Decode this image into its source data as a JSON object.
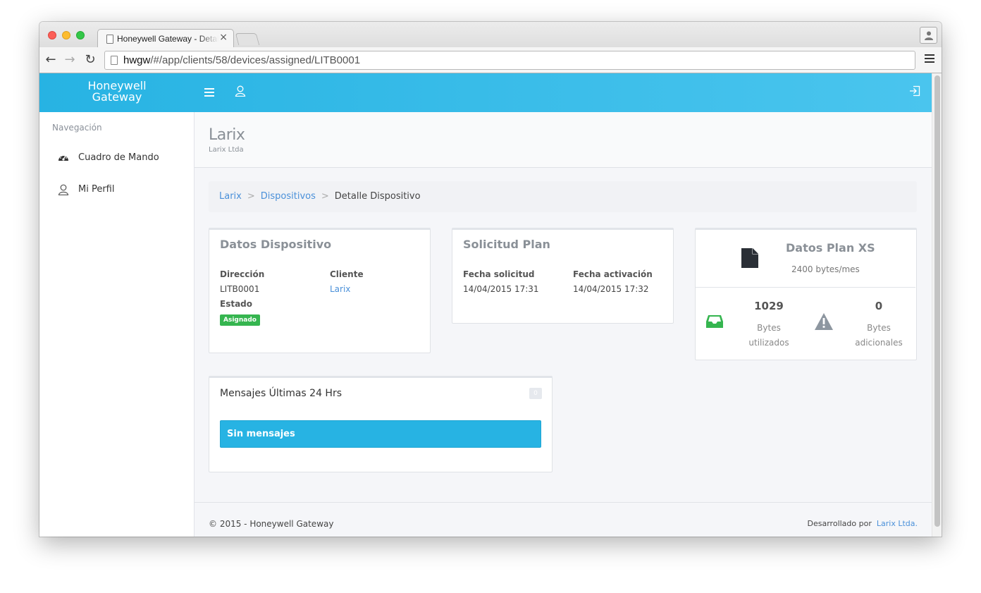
{
  "browser": {
    "tab_title": "Honeywell Gateway - Detalle Dispositivo",
    "tab_close": "×",
    "url_host": "hwgw",
    "url_path": "/#/app/clients/58/devices/assigned/LITB0001"
  },
  "app": {
    "brand_line1": "Honeywell",
    "brand_line2": "Gateway"
  },
  "sidebar": {
    "title": "Navegación",
    "items": [
      {
        "label": "Cuadro de Mando",
        "icon": "dashboard-icon"
      },
      {
        "label": "Mi Perfil",
        "icon": "user-icon"
      }
    ]
  },
  "header": {
    "title": "Larix",
    "subtitle": "Larix Ltda"
  },
  "breadcrumb": {
    "items": [
      "Larix",
      "Dispositivos"
    ],
    "separator": ">",
    "current": "Detalle Dispositivo"
  },
  "device": {
    "title": "Datos Dispositivo",
    "direccion_label": "Dirección",
    "direccion_value": "LITB0001",
    "cliente_label": "Cliente",
    "cliente_value": "Larix",
    "estado_label": "Estado",
    "estado_value": "Asignado"
  },
  "request": {
    "title": "Solicitud Plan",
    "fecha_solicitud_label": "Fecha solicitud",
    "fecha_solicitud_value": "14/04/2015 17:31",
    "fecha_activacion_label": "Fecha activación",
    "fecha_activacion_value": "14/04/2015 17:32"
  },
  "plan": {
    "title": "Datos Plan XS",
    "subtitle": "2400 bytes/mes",
    "used_value": "1029",
    "used_label_1": "Bytes",
    "used_label_2": "utilizados",
    "extra_value": "0",
    "extra_label_1": "Bytes",
    "extra_label_2": "adicionales"
  },
  "messages": {
    "title": "Mensajes Últimas 24 Hrs",
    "count": "0",
    "empty": "Sin mensajes"
  },
  "footer": {
    "copyright": "© 2015 - Honeywell Gateway",
    "developed_by": "Desarrollado por",
    "developer_link": "Larix Ltda."
  },
  "colors": {
    "topbar": "#27b3e3",
    "success": "#35b54f",
    "link": "#4a90d9",
    "info": "#27b3e3"
  }
}
